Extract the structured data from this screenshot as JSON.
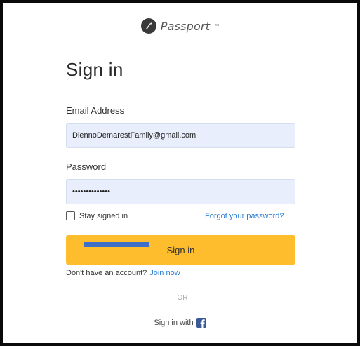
{
  "brand": {
    "name": "Passport",
    "trademark": "™",
    "mark_color": "#3a3a3a"
  },
  "page": {
    "title": "Sign in"
  },
  "form": {
    "email_label": "Email Address",
    "email_value": "DiennoDemarestFamily@gmail.com",
    "password_label": "Password",
    "password_value": "••••••••••••••",
    "stay_signed_in_label": "Stay signed in",
    "stay_signed_in_checked": false,
    "forgot_password_link": "Forgot your password?",
    "sign_in_button": "Sign in"
  },
  "signup": {
    "prompt": "Don't have an account?",
    "link": "Join now"
  },
  "divider": {
    "text": "OR"
  },
  "social": {
    "label": "Sign in with",
    "provider_icon": "facebook-icon"
  },
  "colors": {
    "accent_button": "#fdbd2c",
    "link": "#2a7fd4",
    "input_background": "#e8eefb",
    "redaction_bar": "#3d6fc9",
    "facebook": "#3b5998"
  }
}
